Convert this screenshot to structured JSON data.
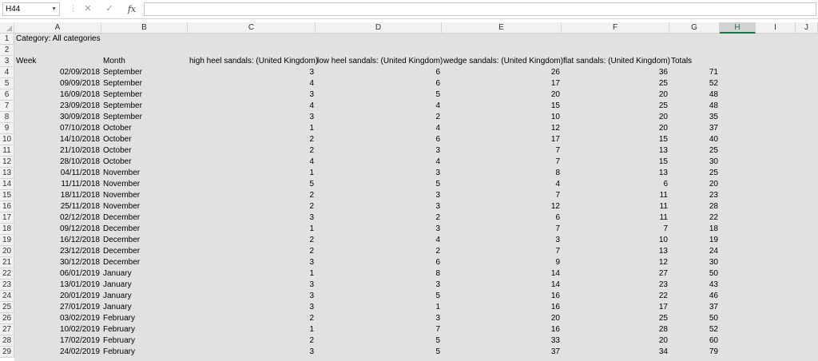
{
  "formula_bar": {
    "name_box": "H44",
    "cancel_glyph": "✕",
    "enter_glyph": "✓",
    "fx_label": "fx",
    "formula": ""
  },
  "selected_column": "H",
  "columns": [
    "A",
    "B",
    "C",
    "D",
    "E",
    "F",
    "G",
    "H",
    "I",
    "J"
  ],
  "rows": [
    [
      "Category: All categories",
      "",
      "",
      "",
      "",
      "",
      ""
    ],
    [
      "",
      "",
      "",
      "",
      "",
      "",
      ""
    ],
    [
      "Week",
      "Month",
      "high heel sandals: (United Kingdom)",
      "low heel sandals: (United Kingdom)",
      "wedge sandals: (United Kingdom)",
      "flat sandals: (United Kingdom)",
      "Totals"
    ],
    [
      "02/09/2018",
      "September",
      "3",
      "6",
      "26",
      "36",
      "71"
    ],
    [
      "09/09/2018",
      "September",
      "4",
      "6",
      "17",
      "25",
      "52"
    ],
    [
      "16/09/2018",
      "September",
      "3",
      "5",
      "20",
      "20",
      "48"
    ],
    [
      "23/09/2018",
      "September",
      "4",
      "4",
      "15",
      "25",
      "48"
    ],
    [
      "30/09/2018",
      "September",
      "3",
      "2",
      "10",
      "20",
      "35"
    ],
    [
      "07/10/2018",
      "October",
      "1",
      "4",
      "12",
      "20",
      "37"
    ],
    [
      "14/10/2018",
      "October",
      "2",
      "6",
      "17",
      "15",
      "40"
    ],
    [
      "21/10/2018",
      "October",
      "2",
      "3",
      "7",
      "13",
      "25"
    ],
    [
      "28/10/2018",
      "October",
      "4",
      "4",
      "7",
      "15",
      "30"
    ],
    [
      "04/11/2018",
      "November",
      "1",
      "3",
      "8",
      "13",
      "25"
    ],
    [
      "11/11/2018",
      "November",
      "5",
      "5",
      "4",
      "6",
      "20"
    ],
    [
      "18/11/2018",
      "November",
      "2",
      "3",
      "7",
      "11",
      "23"
    ],
    [
      "25/11/2018",
      "November",
      "2",
      "3",
      "12",
      "11",
      "28"
    ],
    [
      "02/12/2018",
      "December",
      "3",
      "2",
      "6",
      "11",
      "22"
    ],
    [
      "09/12/2018",
      "December",
      "1",
      "3",
      "7",
      "7",
      "18"
    ],
    [
      "16/12/2018",
      "December",
      "2",
      "4",
      "3",
      "10",
      "19"
    ],
    [
      "23/12/2018",
      "December",
      "2",
      "2",
      "7",
      "13",
      "24"
    ],
    [
      "30/12/2018",
      "December",
      "3",
      "6",
      "9",
      "12",
      "30"
    ],
    [
      "06/01/2019",
      "January",
      "1",
      "8",
      "14",
      "27",
      "50"
    ],
    [
      "13/01/2019",
      "January",
      "3",
      "3",
      "14",
      "23",
      "43"
    ],
    [
      "20/01/2019",
      "January",
      "3",
      "5",
      "16",
      "22",
      "46"
    ],
    [
      "27/01/2019",
      "January",
      "3",
      "1",
      "16",
      "17",
      "37"
    ],
    [
      "03/02/2019",
      "February",
      "2",
      "3",
      "20",
      "25",
      "50"
    ],
    [
      "10/02/2019",
      "February",
      "1",
      "7",
      "16",
      "28",
      "52"
    ],
    [
      "17/02/2019",
      "February",
      "2",
      "5",
      "33",
      "20",
      "60"
    ],
    [
      "24/02/2019",
      "February",
      "3",
      "5",
      "37",
      "34",
      "79"
    ]
  ]
}
